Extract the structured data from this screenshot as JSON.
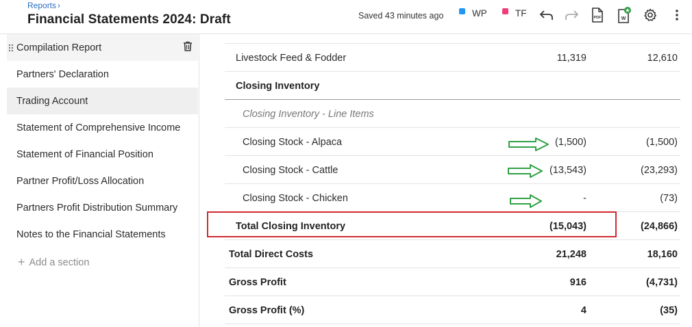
{
  "header": {
    "breadcrumb": "Reports",
    "breadcrumb_sep": "›",
    "title": "Financial Statements 2024: Draft",
    "saved_status": "Saved 43 minutes ago",
    "legend": [
      {
        "label": "WP",
        "color": "#2196f3"
      },
      {
        "label": "TF",
        "color": "#f03e7a"
      }
    ],
    "toolbar_icons": [
      "undo-icon",
      "redo-icon",
      "pdf-icon",
      "word-export-icon",
      "settings-icon",
      "more-vertical-icon"
    ]
  },
  "sidebar": {
    "items": [
      {
        "label": "Compilation Report"
      },
      {
        "label": "Partners' Declaration"
      },
      {
        "label": "Trading Account"
      },
      {
        "label": "Statement of Comprehensive Income"
      },
      {
        "label": "Statement of Financial Position"
      },
      {
        "label": "Partner Profit/Loss Allocation"
      },
      {
        "label": "Partners Profit Distribution Summary"
      },
      {
        "label": "Notes to the Financial Statements"
      }
    ],
    "add_section": "Add a section"
  },
  "table": {
    "rows": [
      {
        "label": "Livestock Feed & Fodder",
        "v1": "11,319",
        "v2": "12,610"
      },
      {
        "label": "Closing Inventory",
        "v1": "",
        "v2": ""
      },
      {
        "label": "Closing Inventory - Line Items",
        "v1": "",
        "v2": ""
      },
      {
        "label": "Closing Stock - Alpaca",
        "v1": "(1,500)",
        "v2": "(1,500)"
      },
      {
        "label": "Closing Stock - Cattle",
        "v1": "(13,543)",
        "v2": "(23,293)"
      },
      {
        "label": "Closing Stock - Chicken",
        "v1": "-",
        "v2": "(73)"
      },
      {
        "label": "Total Closing Inventory",
        "v1": "(15,043)",
        "v2": "(24,866)"
      },
      {
        "label": "Total Direct Costs",
        "v1": "21,248",
        "v2": "18,160"
      },
      {
        "label": "Gross Profit",
        "v1": "916",
        "v2": "(4,731)"
      },
      {
        "label": "Gross Profit (%)",
        "v1": "4",
        "v2": "(35)"
      }
    ]
  },
  "annotations": {
    "highlight_color": "#d0282e",
    "arrow_color": "#2ea043"
  }
}
